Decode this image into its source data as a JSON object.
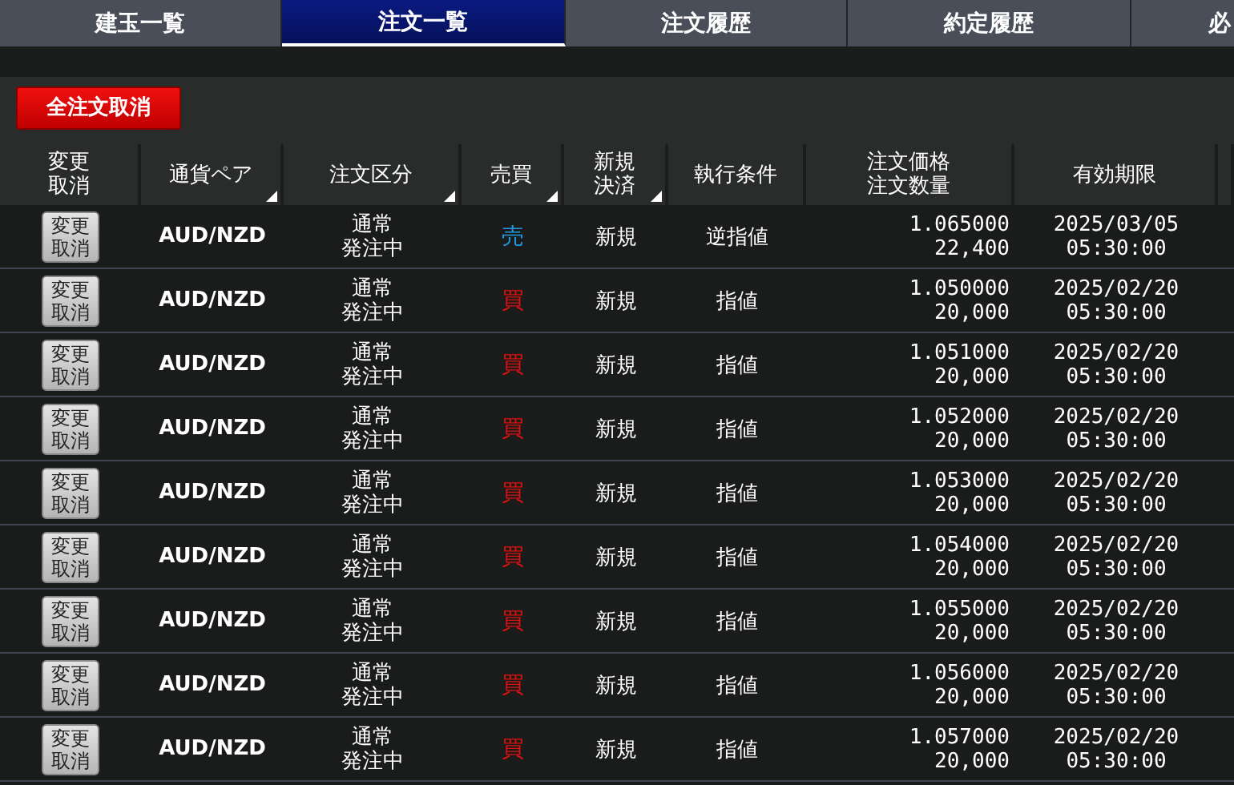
{
  "tabs": [
    {
      "label": "建玉一覧",
      "selected": false
    },
    {
      "label": "注文一覧",
      "selected": true
    },
    {
      "label": "注文履歴",
      "selected": false
    },
    {
      "label": "約定履歴",
      "selected": false
    },
    {
      "label": "必",
      "selected": false
    }
  ],
  "cancel_all_button": "全注文取消",
  "table": {
    "columns": [
      {
        "lines": [
          "変更",
          "取消"
        ],
        "sortable": false
      },
      {
        "lines": [
          "通貨ペア"
        ],
        "sortable": true
      },
      {
        "lines": [
          "注文区分"
        ],
        "sortable": true
      },
      {
        "lines": [
          "売買"
        ],
        "sortable": true
      },
      {
        "lines": [
          "新規",
          "決済"
        ],
        "sortable": true
      },
      {
        "lines": [
          "執行条件"
        ],
        "sortable": false
      },
      {
        "lines": [
          "注文価格",
          "注文数量"
        ],
        "sortable": false
      },
      {
        "lines": [
          "有効期限"
        ],
        "sortable": false
      }
    ],
    "rows": [
      {
        "action": [
          "変更",
          "取消"
        ],
        "pair": "AUD/NZD",
        "type": [
          "通常",
          "発注中"
        ],
        "side": {
          "text": "売",
          "kind": "sell"
        },
        "open_close": "新規",
        "condition": "逆指値",
        "price": "1.065000",
        "quantity": "22,400",
        "expiry": [
          "2025/03/05",
          "05:30:00"
        ]
      },
      {
        "action": [
          "変更",
          "取消"
        ],
        "pair": "AUD/NZD",
        "type": [
          "通常",
          "発注中"
        ],
        "side": {
          "text": "買",
          "kind": "buy"
        },
        "open_close": "新規",
        "condition": "指値",
        "price": "1.050000",
        "quantity": "20,000",
        "expiry": [
          "2025/02/20",
          "05:30:00"
        ]
      },
      {
        "action": [
          "変更",
          "取消"
        ],
        "pair": "AUD/NZD",
        "type": [
          "通常",
          "発注中"
        ],
        "side": {
          "text": "買",
          "kind": "buy"
        },
        "open_close": "新規",
        "condition": "指値",
        "price": "1.051000",
        "quantity": "20,000",
        "expiry": [
          "2025/02/20",
          "05:30:00"
        ]
      },
      {
        "action": [
          "変更",
          "取消"
        ],
        "pair": "AUD/NZD",
        "type": [
          "通常",
          "発注中"
        ],
        "side": {
          "text": "買",
          "kind": "buy"
        },
        "open_close": "新規",
        "condition": "指値",
        "price": "1.052000",
        "quantity": "20,000",
        "expiry": [
          "2025/02/20",
          "05:30:00"
        ]
      },
      {
        "action": [
          "変更",
          "取消"
        ],
        "pair": "AUD/NZD",
        "type": [
          "通常",
          "発注中"
        ],
        "side": {
          "text": "買",
          "kind": "buy"
        },
        "open_close": "新規",
        "condition": "指値",
        "price": "1.053000",
        "quantity": "20,000",
        "expiry": [
          "2025/02/20",
          "05:30:00"
        ]
      },
      {
        "action": [
          "変更",
          "取消"
        ],
        "pair": "AUD/NZD",
        "type": [
          "通常",
          "発注中"
        ],
        "side": {
          "text": "買",
          "kind": "buy"
        },
        "open_close": "新規",
        "condition": "指値",
        "price": "1.054000",
        "quantity": "20,000",
        "expiry": [
          "2025/02/20",
          "05:30:00"
        ]
      },
      {
        "action": [
          "変更",
          "取消"
        ],
        "pair": "AUD/NZD",
        "type": [
          "通常",
          "発注中"
        ],
        "side": {
          "text": "買",
          "kind": "buy"
        },
        "open_close": "新規",
        "condition": "指値",
        "price": "1.055000",
        "quantity": "20,000",
        "expiry": [
          "2025/02/20",
          "05:30:00"
        ]
      },
      {
        "action": [
          "変更",
          "取消"
        ],
        "pair": "AUD/NZD",
        "type": [
          "通常",
          "発注中"
        ],
        "side": {
          "text": "買",
          "kind": "buy"
        },
        "open_close": "新規",
        "condition": "指値",
        "price": "1.056000",
        "quantity": "20,000",
        "expiry": [
          "2025/02/20",
          "05:30:00"
        ]
      },
      {
        "action": [
          "変更",
          "取消"
        ],
        "pair": "AUD/NZD",
        "type": [
          "通常",
          "発注中"
        ],
        "side": {
          "text": "買",
          "kind": "buy"
        },
        "open_close": "新規",
        "condition": "指値",
        "price": "1.057000",
        "quantity": "20,000",
        "expiry": [
          "2025/02/20",
          "05:30:00"
        ]
      }
    ]
  }
}
